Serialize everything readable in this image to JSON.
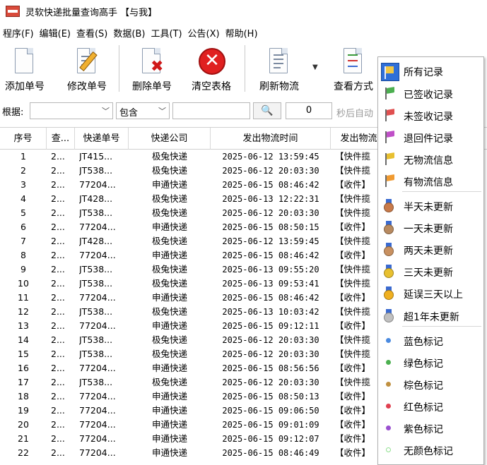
{
  "window": {
    "title": "灵软快递批量查询高手 【与我】"
  },
  "menu": [
    "程序(F)",
    "编辑(E)",
    "查看(S)",
    "数据(B)",
    "工具(T)",
    "公告(X)",
    "帮助(H)"
  ],
  "toolbar": {
    "add": "添加单号",
    "edit": "修改单号",
    "delete": "删除单号",
    "clear": "清空表格",
    "refresh": "刷新物流",
    "view": "查看方式"
  },
  "filter": {
    "label": "根据:",
    "field_value": "",
    "operator_value": "包含",
    "search_value": "",
    "count": "0",
    "auto_text": "秒后自动"
  },
  "grid": {
    "headers": [
      "序号",
      "查...",
      "快递单号",
      "快递公司",
      "发出物流时间",
      "发出物流"
    ],
    "rows": [
      {
        "no": "1",
        "c2": "2...",
        "track": "JT415...",
        "company": "极兔快递",
        "time": "2025-06-12 13:59:45",
        "info": "【快件揽"
      },
      {
        "no": "2",
        "c2": "2...",
        "track": "JT538...",
        "company": "极兔快递",
        "time": "2025-06-12 20:03:30",
        "info": "【快件揽"
      },
      {
        "no": "3",
        "c2": "2...",
        "track": "77204...",
        "company": "申通快递",
        "time": "2025-06-15 08:46:42",
        "info": "【收件】"
      },
      {
        "no": "4",
        "c2": "2...",
        "track": "JT428...",
        "company": "极兔快递",
        "time": "2025-06-13 12:22:31",
        "info": "【快件揽"
      },
      {
        "no": "5",
        "c2": "2...",
        "track": "JT538...",
        "company": "极兔快递",
        "time": "2025-06-12 20:03:30",
        "info": "【快件揽"
      },
      {
        "no": "6",
        "c2": "2...",
        "track": "77204...",
        "company": "申通快递",
        "time": "2025-06-15 08:50:15",
        "info": "【收件】"
      },
      {
        "no": "7",
        "c2": "2...",
        "track": "JT428...",
        "company": "极兔快递",
        "time": "2025-06-12 13:59:45",
        "info": "【快件揽"
      },
      {
        "no": "8",
        "c2": "2...",
        "track": "77204...",
        "company": "申通快递",
        "time": "2025-06-15 08:46:42",
        "info": "【收件】"
      },
      {
        "no": "9",
        "c2": "2...",
        "track": "JT538...",
        "company": "极兔快递",
        "time": "2025-06-13 09:55:20",
        "info": "【快件揽"
      },
      {
        "no": "10",
        "c2": "2...",
        "track": "JT538...",
        "company": "极兔快递",
        "time": "2025-06-13 09:53:41",
        "info": "【快件揽"
      },
      {
        "no": "11",
        "c2": "2...",
        "track": "77204...",
        "company": "申通快递",
        "time": "2025-06-15 08:46:42",
        "info": "【收件】"
      },
      {
        "no": "12",
        "c2": "2...",
        "track": "JT538...",
        "company": "极兔快递",
        "time": "2025-06-13 10:03:42",
        "info": "【快件揽"
      },
      {
        "no": "13",
        "c2": "2...",
        "track": "77204...",
        "company": "申通快递",
        "time": "2025-06-15 09:12:11",
        "info": "【收件】"
      },
      {
        "no": "14",
        "c2": "2...",
        "track": "JT538...",
        "company": "极兔快递",
        "time": "2025-06-12 20:03:30",
        "info": "【快件揽"
      },
      {
        "no": "15",
        "c2": "2...",
        "track": "JT538...",
        "company": "极兔快递",
        "time": "2025-06-12 20:03:30",
        "info": "【快件揽"
      },
      {
        "no": "16",
        "c2": "2...",
        "track": "77204...",
        "company": "申通快递",
        "time": "2025-06-15 08:56:56",
        "info": "【收件】"
      },
      {
        "no": "17",
        "c2": "2...",
        "track": "JT538...",
        "company": "极兔快递",
        "time": "2025-06-12 20:03:30",
        "info": "【快件揽"
      },
      {
        "no": "18",
        "c2": "2...",
        "track": "77204...",
        "company": "申通快递",
        "time": "2025-06-15 08:50:13",
        "info": "【收件】"
      },
      {
        "no": "19",
        "c2": "2...",
        "track": "77204...",
        "company": "申通快递",
        "time": "2025-06-15 09:06:50",
        "info": "【收件】"
      },
      {
        "no": "20",
        "c2": "2...",
        "track": "77204...",
        "company": "申通快递",
        "time": "2025-06-15 09:01:09",
        "info": "【收件】"
      },
      {
        "no": "21",
        "c2": "2...",
        "track": "77204...",
        "company": "申通快递",
        "time": "2025-06-15 09:12:07",
        "info": "【收件】"
      },
      {
        "no": "22",
        "c2": "2...",
        "track": "77204...",
        "company": "申通快递",
        "time": "2025-06-15 08:46:49",
        "info": "【收件】"
      }
    ]
  },
  "popup": {
    "items": [
      {
        "label": "所有记录",
        "icon": "all-records-icon",
        "color": "#2f6fd8"
      },
      {
        "label": "已签收记录",
        "icon": "green-flag-icon",
        "color": "#4caf50"
      },
      {
        "label": "未签收记录",
        "icon": "red-flag-icon",
        "color": "#e05050"
      },
      {
        "label": "退回件记录",
        "icon": "purple-flag-icon",
        "color": "#c050c8"
      },
      {
        "label": "无物流信息",
        "icon": "yellow-flag-icon",
        "color": "#e8c030"
      },
      {
        "label": "有物流信息",
        "icon": "orange-flag-icon",
        "color": "#f09a30"
      },
      {
        "label": "半天未更新",
        "icon": "bronze-medal-icon",
        "color": "#c87a4a"
      },
      {
        "label": "一天未更新",
        "icon": "bronze-medal-icon",
        "color": "#b88a60"
      },
      {
        "label": "两天未更新",
        "icon": "bronze-medal-icon",
        "color": "#c89060"
      },
      {
        "label": "三天未更新",
        "icon": "gold-medal-icon",
        "color": "#e8c030"
      },
      {
        "label": "延误三天以上",
        "icon": "gold-medal-icon",
        "color": "#f0b020"
      },
      {
        "label": "超1年未更新",
        "icon": "silver-medal-icon",
        "color": "#c0c0c0"
      },
      {
        "label": "蓝色标记",
        "icon": "blue-dot-icon",
        "color": "#4a8ae0"
      },
      {
        "label": "绿色标记",
        "icon": "green-dot-icon",
        "color": "#4cb050"
      },
      {
        "label": "棕色标记",
        "icon": "brown-dot-icon",
        "color": "#c09040"
      },
      {
        "label": "红色标记",
        "icon": "red-dot-icon",
        "color": "#e04050"
      },
      {
        "label": "紫色标记",
        "icon": "purple-dot-icon",
        "color": "#9a50d0"
      },
      {
        "label": "无颜色标记",
        "icon": "empty-dot-icon",
        "color": "#90e090"
      }
    ]
  }
}
